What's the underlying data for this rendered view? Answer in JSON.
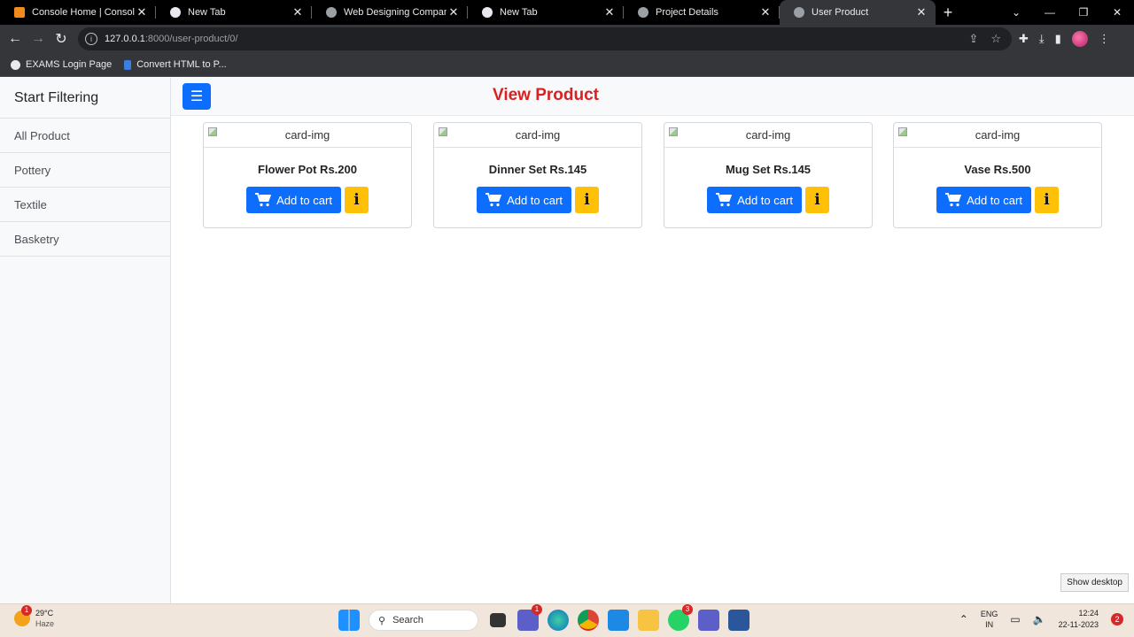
{
  "browser": {
    "tabs": [
      {
        "title": "Console Home | Console Hor",
        "icon": "aws-icon",
        "color": "#f28b1e"
      },
      {
        "title": "New Tab",
        "icon": "chrome-icon",
        "color": "#e8eaed"
      },
      {
        "title": "Web Designing Company",
        "icon": "globe-icon",
        "color": "#9aa0a6"
      },
      {
        "title": "New Tab",
        "icon": "chrome-icon",
        "color": "#e8eaed"
      },
      {
        "title": "Project Details",
        "icon": "globe-icon",
        "color": "#9aa0a6"
      },
      {
        "title": "User Product",
        "icon": "globe-icon",
        "color": "#9aa0a6"
      }
    ],
    "url_host": "127.0.0.1",
    "url_path": ":8000/user-product/0/",
    "bookmarks": [
      {
        "label": "EXAMS Login Page"
      },
      {
        "label": "Convert HTML to P..."
      }
    ]
  },
  "sidebar": {
    "title": "Start Filtering",
    "items": [
      "All Product",
      "Pottery",
      "Textile",
      "Basketry"
    ]
  },
  "header": {
    "title": "View Product"
  },
  "products": [
    {
      "img_alt": "card-img",
      "name": "Flower Pot Rs.200",
      "cart_label": "Add to cart",
      "info_label": "i"
    },
    {
      "img_alt": "card-img",
      "name": "Dinner Set Rs.145",
      "cart_label": "Add to cart",
      "info_label": "i"
    },
    {
      "img_alt": "card-img",
      "name": "Mug Set Rs.145",
      "cart_label": "Add to cart",
      "info_label": "i"
    },
    {
      "img_alt": "card-img",
      "name": "Vase Rs.500",
      "cart_label": "Add to cart",
      "info_label": "i"
    }
  ],
  "tooltip": "Show desktop",
  "taskbar": {
    "weather_temp": "29°C",
    "weather_desc": "Haze",
    "weather_badge": "1",
    "search_label": "Search",
    "chat_badge": "1",
    "whatsapp_badge": "3",
    "lang_top": "ENG",
    "lang_bottom": "IN",
    "time": "12:24",
    "date": "22-11-2023",
    "notifications": "2"
  },
  "colors": {
    "primary": "#0d6efd",
    "warning": "#ffc107",
    "title_red": "#dc1f1f"
  }
}
